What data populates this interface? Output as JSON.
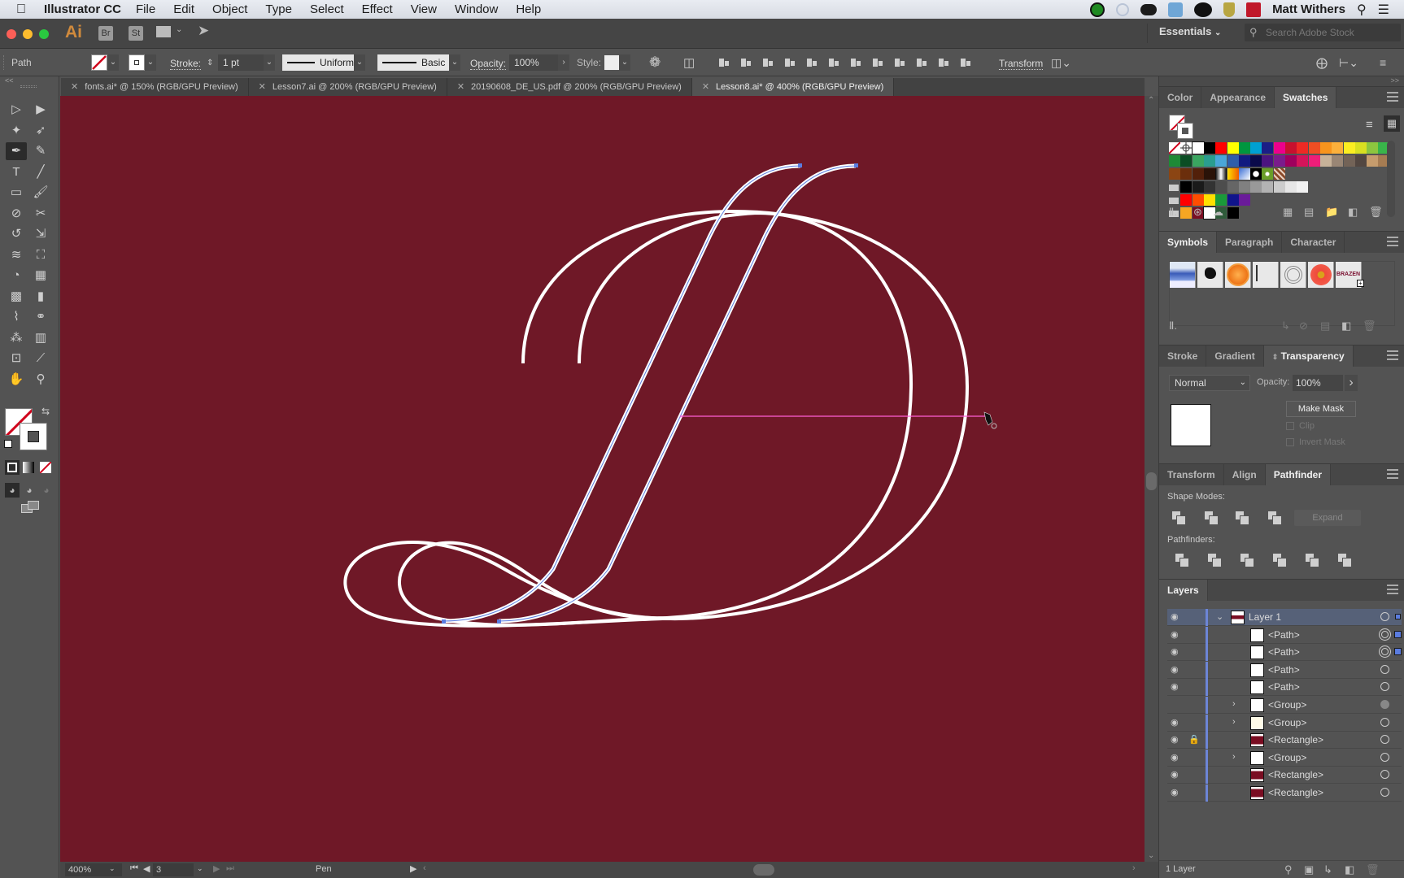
{
  "menubar": {
    "app_name": "Illustrator CC",
    "items": [
      "File",
      "Edit",
      "Object",
      "Type",
      "Select",
      "Effect",
      "View",
      "Window",
      "Help"
    ],
    "user": "Matt Withers"
  },
  "appbar": {
    "logo": "Ai",
    "bridge": "Br",
    "stock": "St",
    "workspace": "Essentials",
    "search_placeholder": "Search Adobe Stock"
  },
  "controlbar": {
    "selection_type": "Path",
    "stroke_label": "Stroke:",
    "stroke_weight": "1 pt",
    "variable_width": "Uniform",
    "brush": "Basic",
    "opacity_label": "Opacity:",
    "opacity_value": "100%",
    "style_label": "Style:",
    "transform_label": "Transform"
  },
  "document_tabs": [
    {
      "label": "fonts.ai* @ 150% (RGB/GPU Preview)",
      "active": false
    },
    {
      "label": "Lesson7.ai @ 200% (RGB/GPU Preview)",
      "active": false
    },
    {
      "label": "20190608_DE_US.pdf @ 200% (RGB/GPU Preview)",
      "active": false
    },
    {
      "label": "Lesson8.ai* @ 400% (RGB/GPU Preview)",
      "active": true
    }
  ],
  "tools": [
    {
      "name": "selection-tool",
      "glyph": "▷"
    },
    {
      "name": "direct-selection-tool",
      "glyph": "▶"
    },
    {
      "name": "magic-wand-tool",
      "glyph": "✦"
    },
    {
      "name": "lasso-tool",
      "glyph": "➶"
    },
    {
      "name": "pen-tool",
      "glyph": "✒",
      "active": true
    },
    {
      "name": "curvature-tool",
      "glyph": "✎"
    },
    {
      "name": "type-tool",
      "glyph": "T"
    },
    {
      "name": "line-segment-tool",
      "glyph": "╱"
    },
    {
      "name": "rectangle-tool",
      "glyph": "▭"
    },
    {
      "name": "paintbrush-tool",
      "glyph": "🖌"
    },
    {
      "name": "shaper-tool",
      "glyph": "⊘"
    },
    {
      "name": "scissors-tool",
      "glyph": "✂"
    },
    {
      "name": "rotate-tool",
      "glyph": "↺"
    },
    {
      "name": "scale-tool",
      "glyph": "⇲"
    },
    {
      "name": "warp-tool",
      "glyph": "≋"
    },
    {
      "name": "free-transform-tool",
      "glyph": "⛶"
    },
    {
      "name": "shape-builder-tool",
      "glyph": "◔"
    },
    {
      "name": "perspective-grid-tool",
      "glyph": "▦"
    },
    {
      "name": "mesh-tool",
      "glyph": "▩"
    },
    {
      "name": "gradient-tool",
      "glyph": "▮"
    },
    {
      "name": "eyedropper-tool",
      "glyph": "⌇"
    },
    {
      "name": "blend-tool",
      "glyph": "⚭"
    },
    {
      "name": "symbol-sprayer-tool",
      "glyph": "⁂"
    },
    {
      "name": "column-graph-tool",
      "glyph": "▥"
    },
    {
      "name": "artboard-tool",
      "glyph": "⊡"
    },
    {
      "name": "slice-tool",
      "glyph": "⟋"
    },
    {
      "name": "hand-tool",
      "glyph": "✋"
    },
    {
      "name": "zoom-tool",
      "glyph": "⚲"
    }
  ],
  "statusbar": {
    "zoom": "400%",
    "artboard": "3",
    "current_tool": "Pen"
  },
  "canvas": {
    "background_color": "#6f1827",
    "stroke_color": "#ffffff",
    "selection_color": "#5a7ce0",
    "guide_color": "#ff5fd6"
  },
  "panels": {
    "color_group": {
      "tabs": [
        "Color",
        "Appearance",
        "Swatches"
      ],
      "active": "Swatches",
      "swatch_rows": [
        [
          "none",
          "registration",
          "#ffffff",
          "#000000",
          "#ff0000",
          "#ffff00",
          "#00963f",
          "#00a0d2",
          "#1b1e86",
          "#ec008c",
          "#c8102e",
          "#ee2a24",
          "#f04e23",
          "#f7941d",
          "#fbb03b",
          "#fcee21",
          "#d9e021",
          "#8cc63f",
          "#39b54a"
        ],
        [
          "#1e8a36",
          "#0b4d24",
          "#3aa660",
          "#2a9d8f",
          "#4aa6d8",
          "#2f5eaa",
          "#111a80",
          "#0a0a4a",
          "#4b1480",
          "#7b1c8c",
          "#9e005d",
          "#d4145a",
          "#ed1e79",
          "#c7b299",
          "#998675",
          "#736357",
          "#534741",
          "#c69c6d",
          "#a67c52"
        ],
        [
          "#8b4513",
          "#6b2e0c",
          "#52200a",
          "#2a1308",
          "grad-gray",
          "grad-orange",
          "grad-blue",
          "pattern-dots",
          "pattern-green",
          "pattern-brown"
        ],
        [
          "folder",
          "#000000",
          "#1a1a1a",
          "#333333",
          "#4d4d4d",
          "#666666",
          "#808080",
          "#999999",
          "#b3b3b3",
          "#cccccc",
          "#e6e6e6",
          "#f2f2f2"
        ],
        [
          "folder",
          "#ff0000",
          "#ff4d00",
          "#ffe000",
          "#1a9a3a",
          "#10148c",
          "#6a1b9a"
        ],
        [
          "folder",
          "#f6a623",
          "#7a0d22",
          "#ffffff",
          "#2f5b3a",
          "#000000"
        ]
      ]
    },
    "symbols_group": {
      "tabs": [
        "Symbols",
        "Paragraph",
        "Character"
      ],
      "active": "Symbols",
      "symbols": [
        "blue-banner",
        "ink-splat",
        "orange-button",
        "grunge-frame",
        "wreath",
        "red-flower",
        "brazen-logo"
      ],
      "brazen_text": "BRAZEN"
    },
    "transparency_group": {
      "tabs": [
        "Stroke",
        "Gradient",
        "Transparency"
      ],
      "active": "Transparency",
      "blend_mode": "Normal",
      "opacity_label": "Opacity:",
      "opacity_value": "100%",
      "make_mask": "Make Mask",
      "clip": "Clip",
      "invert_mask": "Invert Mask"
    },
    "pathfinder_group": {
      "tabs": [
        "Transform",
        "Align",
        "Pathfinder"
      ],
      "active": "Pathfinder",
      "shape_modes_label": "Shape Modes:",
      "pathfinders_label": "Pathfinders:",
      "expand": "Expand"
    },
    "layers": {
      "title": "Layers",
      "footer": "1 Layer",
      "rows": [
        {
          "name": "Layer 1",
          "level": 0,
          "visible": true,
          "locked": false,
          "expandable": true,
          "expanded": true,
          "thumb": "layer",
          "target": "single",
          "selected": true
        },
        {
          "name": "<Path>",
          "level": 1,
          "visible": true,
          "locked": false,
          "expandable": false,
          "thumb": "white",
          "target": "double",
          "selected": true
        },
        {
          "name": "<Path>",
          "level": 1,
          "visible": true,
          "locked": false,
          "expandable": false,
          "thumb": "white",
          "target": "double",
          "selected": true
        },
        {
          "name": "<Path>",
          "level": 1,
          "visible": true,
          "locked": false,
          "expandable": false,
          "thumb": "white",
          "target": "single",
          "selected": false
        },
        {
          "name": "<Path>",
          "level": 1,
          "visible": true,
          "locked": false,
          "expandable": false,
          "thumb": "white",
          "target": "single",
          "selected": false
        },
        {
          "name": "<Group>",
          "level": 1,
          "visible": false,
          "locked": false,
          "expandable": true,
          "thumb": "white",
          "target": "filled",
          "selected": false
        },
        {
          "name": "<Group>",
          "level": 1,
          "visible": true,
          "locked": false,
          "expandable": true,
          "thumb": "script",
          "target": "single",
          "selected": false
        },
        {
          "name": "<Rectangle>",
          "level": 1,
          "visible": true,
          "locked": true,
          "expandable": false,
          "thumb": "rect",
          "target": "single",
          "selected": false
        },
        {
          "name": "<Group>",
          "level": 1,
          "visible": true,
          "locked": false,
          "expandable": true,
          "thumb": "white",
          "target": "single",
          "selected": false
        },
        {
          "name": "<Rectangle>",
          "level": 1,
          "visible": true,
          "locked": false,
          "expandable": false,
          "thumb": "rect",
          "target": "single",
          "selected": false
        },
        {
          "name": "<Rectangle>",
          "level": 1,
          "visible": true,
          "locked": false,
          "expandable": false,
          "thumb": "rect",
          "target": "single",
          "selected": false
        }
      ]
    }
  }
}
